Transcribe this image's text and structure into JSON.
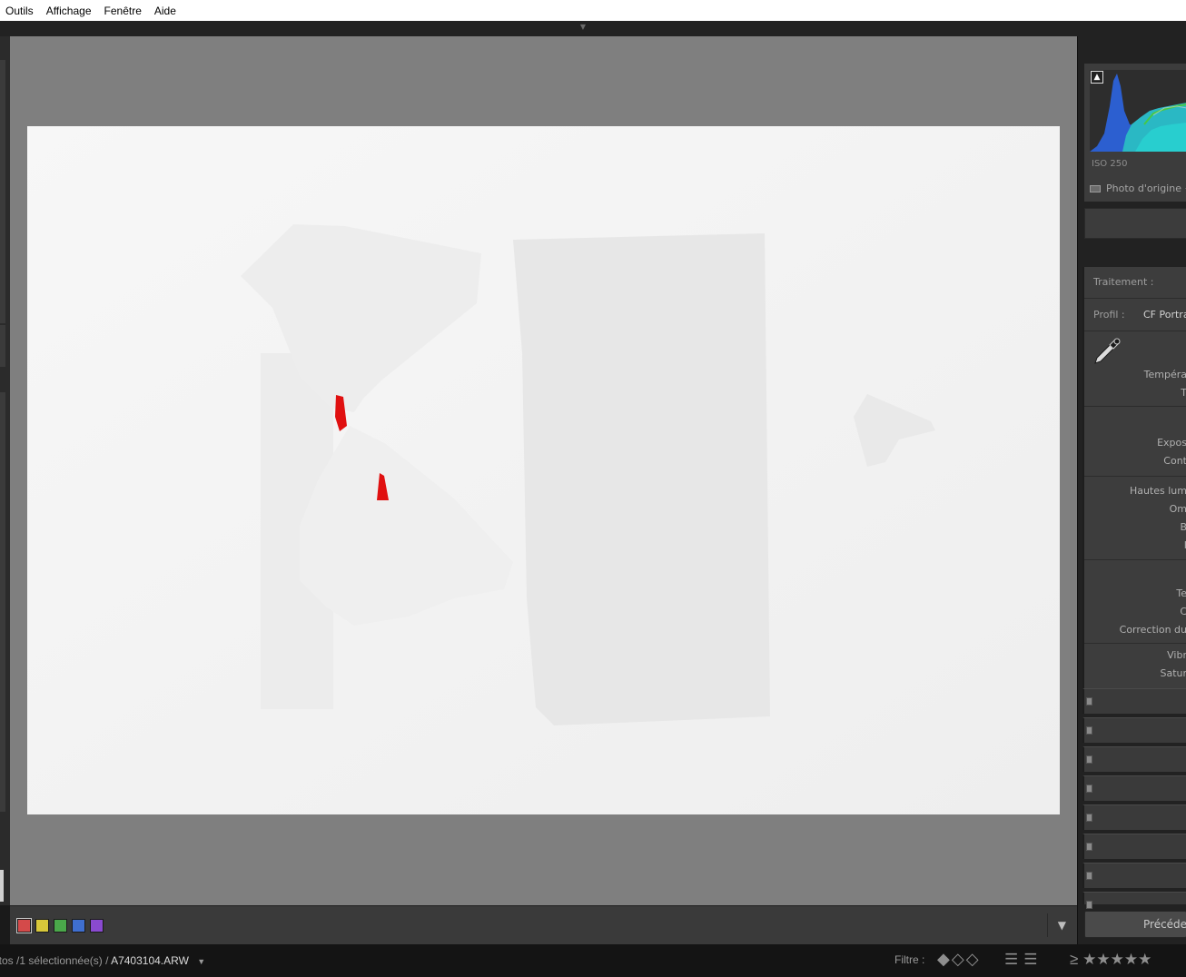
{
  "menu": {
    "items": [
      {
        "label": "Outils"
      },
      {
        "label": "Affichage"
      },
      {
        "label": "Fenêtre"
      },
      {
        "label": "Aide"
      }
    ]
  },
  "histogram": {
    "iso": "ISO 250",
    "original_label": "Photo d'origine + a"
  },
  "develop": {
    "traitement_label": "Traitement :",
    "profil_label": "Profil :",
    "profil_value": "CF Portrai",
    "labels": {
      "temperature": "Tempéra",
      "tint": "T",
      "exposure": "Expos",
      "contrast": "Cont",
      "highlights": "Hautes lum",
      "shadows": "Om",
      "whites": "B",
      "blacks": "I",
      "texture": "Te",
      "clarity": "C",
      "dehaze": "Correction du",
      "vibrance": "Vibr",
      "saturation": "Satur"
    }
  },
  "buttons": {
    "previous": "Précéden"
  },
  "toolbar": {
    "color_labels": [
      {
        "name": "red",
        "color": "#d44a4a"
      },
      {
        "name": "yellow",
        "color": "#d8c83a"
      },
      {
        "name": "green",
        "color": "#4aa84a"
      },
      {
        "name": "blue",
        "color": "#3f6fd0"
      },
      {
        "name": "purple",
        "color": "#8a4ad0"
      }
    ]
  },
  "status": {
    "photos_text": "otos /1 sélectionnée(s) /",
    "filename": "A7403104.ARW",
    "filter_label": "Filtre :",
    "rating_prefix": "≥"
  }
}
